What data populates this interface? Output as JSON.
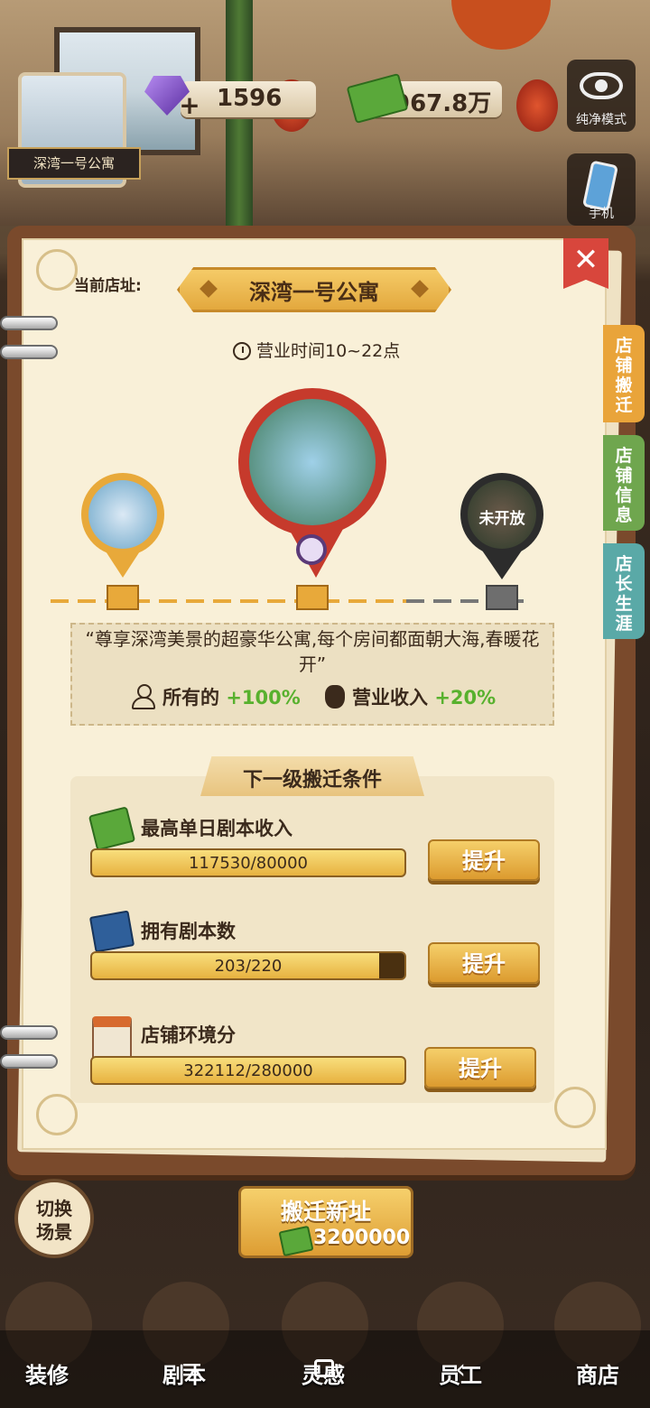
{
  "hud": {
    "gems": "1596",
    "cash": "967.8万",
    "location_tag": "深湾一号公寓",
    "pure_mode": "纯净模式",
    "phone": "手机"
  },
  "panel": {
    "current_label": "当前店址:",
    "store_name": "深湾一号公寓",
    "hours": "营业时间10~22点",
    "locked_label": "未开放",
    "description": "“尊享深湾美景的超豪华公寓,每个房间都面朝大海,春暖花开”",
    "bonus_all_label": "所有的",
    "bonus_all_value": "+100%",
    "bonus_income_label": "营业收入",
    "bonus_income_value": "+20%",
    "next_title": "下一级搬迁条件",
    "conditions": [
      {
        "label": "最高单日剧本收入",
        "progress": "117530/80000",
        "fill": 1.0,
        "button": "提升"
      },
      {
        "label": "拥有剧本数",
        "progress": "203/220",
        "fill": 0.92,
        "button": "提升"
      },
      {
        "label": "店铺环境分",
        "progress": "322112/280000",
        "fill": 1.0,
        "button": "提升"
      }
    ]
  },
  "tabs": [
    "店铺搬迁",
    "店铺信息",
    "店长生涯"
  ],
  "tab_colors": [
    "#e9a43a",
    "#6fa64e",
    "#5aa9a7"
  ],
  "bottom": {
    "switch_scene": "切换场景",
    "move_title": "搬迁新址",
    "move_cost": "3200000",
    "nav": [
      "装修",
      "剧本",
      "灵感",
      "员工",
      "商店"
    ]
  }
}
